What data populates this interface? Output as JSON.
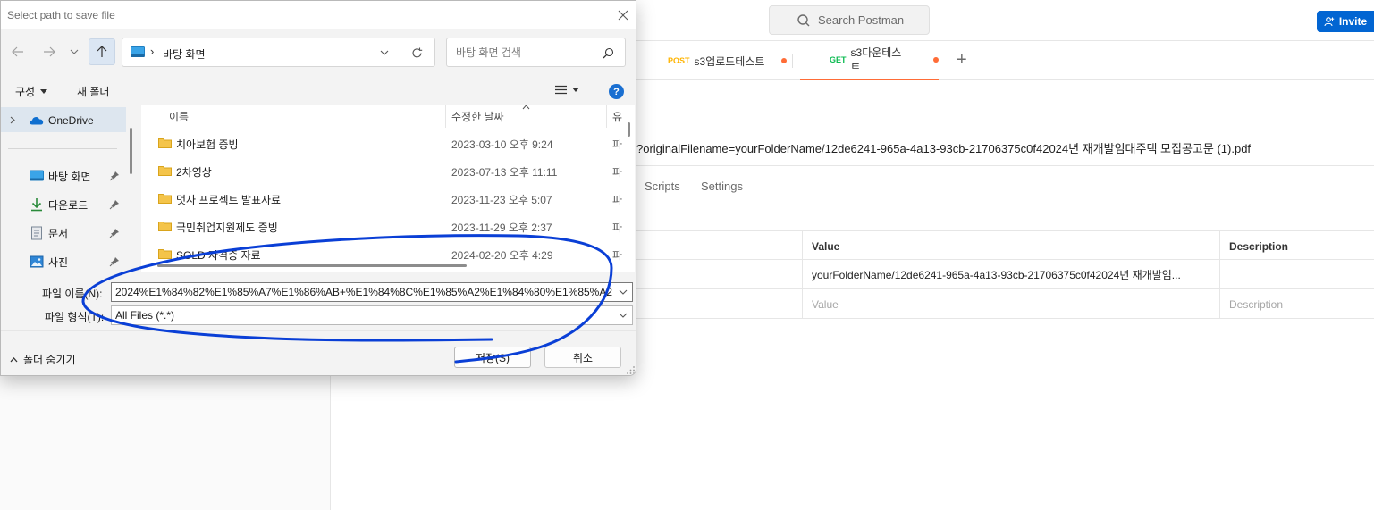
{
  "postman": {
    "search_placeholder": "Search Postman",
    "invite_label": "Invite",
    "tabs": [
      {
        "method": "POST",
        "name": "s3업로드테스트",
        "method_color": "#ffb400"
      },
      {
        "method": "GET",
        "name": "s3다운테스트",
        "method_color": "#0cbb52"
      }
    ],
    "url_text": "?originalFilename=yourFolderName/12de6241-965a-4a13-93cb-21706375c0f42024년 재개발임대주택 모집공고문 (1).pdf",
    "subtabs": [
      "Scripts",
      "Settings"
    ],
    "params_table": {
      "headers": [
        "Value",
        "Description"
      ],
      "rows": [
        {
          "value": "yourFolderName/12de6241-965a-4a13-93cb-21706375c0f42024년 재개발임...",
          "description": ""
        }
      ],
      "placeholder_row": {
        "value": "Value",
        "description": "Description"
      }
    },
    "accent_color": "#ff6c37",
    "invite_color": "#0265d2"
  },
  "dialog": {
    "title": "Select path to save file",
    "address_path": "바탕 화면",
    "search_placeholder": "바탕 화면 검색",
    "toolbar": {
      "organize": "구성",
      "new_folder": "새 폴더"
    },
    "nav_tree": [
      {
        "label": "OneDrive",
        "icon": "onedrive-icon",
        "pinned": false
      },
      {
        "label": "바탕 화면",
        "icon": "desktop-icon",
        "pinned": true
      },
      {
        "label": "다운로드",
        "icon": "download-icon",
        "pinned": true
      },
      {
        "label": "문서",
        "icon": "document-icon",
        "pinned": true
      },
      {
        "label": "사진",
        "icon": "picture-icon",
        "pinned": true
      }
    ],
    "columns": {
      "name": "이름",
      "modified": "수정한 날짜",
      "type": "유"
    },
    "files": [
      {
        "name": "치아보험 증빙",
        "modified": "2023-03-10 오후 9:24",
        "type": "파"
      },
      {
        "name": "2차영상",
        "modified": "2023-07-13 오후 11:11",
        "type": "파"
      },
      {
        "name": "멋사 프로젝트 발표자료",
        "modified": "2023-11-23 오후 5:07",
        "type": "파"
      },
      {
        "name": "국민취업지원제도 증빙",
        "modified": "2023-11-29 오후 2:37",
        "type": "파"
      },
      {
        "name": "SOLD 자격증 자료",
        "modified": "2024-02-20 오후 4:29",
        "type": "파"
      }
    ],
    "filename_label": "파일 이름(N):",
    "filename_value": "2024%E1%84%82%E1%85%A7%E1%86%AB+%E1%84%8C%E1%85%A2%E1%84%80%E1%85%A2%E",
    "filetype_label": "파일 형식(T):",
    "filetype_value": "All Files (*.*)",
    "hide_folders": "폴더 숨기기",
    "save_button": "저장(S)",
    "cancel_button": "취소",
    "annotation_color": "#0a3fd6"
  }
}
